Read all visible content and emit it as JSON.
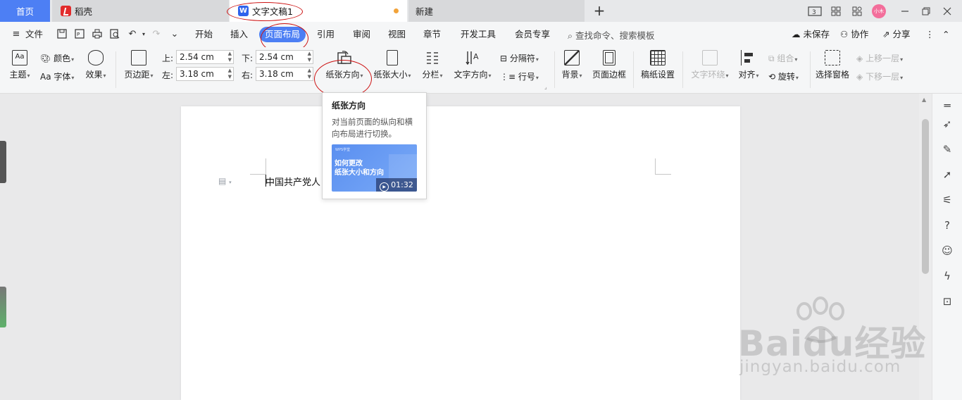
{
  "tabs": {
    "home": "首页",
    "daoke": "稻壳",
    "document": "文字文稿1",
    "new": "新建",
    "add": "+"
  },
  "window": {
    "avatar_text": "小木"
  },
  "menu": {
    "file": "文件",
    "items": [
      "开始",
      "插入",
      "页面布局",
      "引用",
      "审阅",
      "视图",
      "章节",
      "开发工具",
      "会员专享"
    ],
    "search": "查找命令、搜索模板",
    "unsaved": "未保存",
    "collab": "协作",
    "share": "分享"
  },
  "ribbon": {
    "theme": "主题",
    "color": "颜色",
    "font": "Aa 字体",
    "effect": "效果",
    "margins": "页边距",
    "margin_top_label": "上:",
    "margin_top": "2.54 cm",
    "margin_bottom_label": "下:",
    "margin_bottom": "2.54 cm",
    "margin_left_label": "左:",
    "margin_left": "3.18 cm",
    "margin_right_label": "右:",
    "margin_right": "3.18 cm",
    "orientation": "纸张方向",
    "size": "纸张大小",
    "columns": "分栏",
    "text_direction": "文字方向",
    "separator": "分隔符",
    "line_number": "行号",
    "background": "背景",
    "page_border": "页面边框",
    "manuscript": "稿纸设置",
    "wrap": "文字环绕",
    "align": "对齐",
    "group": "组合",
    "rotate": "旋转",
    "selection_pane": "选择窗格",
    "bring_forward": "上移一层",
    "send_backward": "下移一层"
  },
  "tooltip": {
    "title": "纸张方向",
    "desc": "对当前页面的纵向和横向布局进行切换。",
    "video_brand": "WPS学堂",
    "video_title": "如何更改\n纸张大小和方向",
    "duration": "01:32"
  },
  "document": {
    "text": "中国共产党人"
  },
  "watermark": {
    "brand": "Baidu经验",
    "url": "jingyan.baidu.com"
  },
  "colors": {
    "accent": "#4d7ff4",
    "annotation": "#cc1111",
    "unsaved_dot": "#f2a33a"
  }
}
